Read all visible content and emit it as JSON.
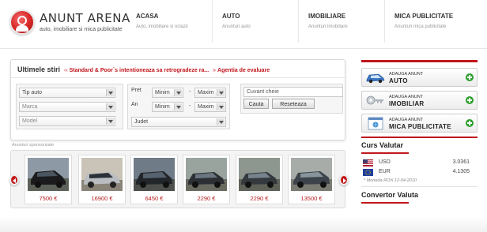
{
  "header": {
    "logo_title": "ANUNT ARENA",
    "logo_subtitle": "auto, imobiliare si mica publicitate",
    "nav": [
      {
        "label": "ACASA",
        "sub": "Auto, imobiliare si oclazii"
      },
      {
        "label": "AUTO",
        "sub": "Anunturi auto"
      },
      {
        "label": "IMOBILIARE",
        "sub": "Anunturi imobiliare"
      },
      {
        "label": "MICA PUBLICITATE",
        "sub": "Anunturi mica publicitate"
      }
    ]
  },
  "news": {
    "title": "Ultimele stiri",
    "arrow": "‹‹",
    "headline": "Standard & Poor`s intentioneaza sa retrogradeze ra...",
    "sep": "»",
    "source": "Agentia de evaluare"
  },
  "filters": {
    "tip": "Tip auto",
    "marca": "Marca",
    "model": "Model",
    "pret_label": "Pret",
    "an_label": "An",
    "pret_min": "Minim",
    "pret_max": "Maxim",
    "an_min": "Minim",
    "an_max": "Maxim",
    "dash": "-",
    "judet": "Judet",
    "keyword_placeholder": "Cuvant cheie",
    "search_button": "Cauta",
    "reset_button": "Reseteaza"
  },
  "sponsored": {
    "label": "Anunturi sponsorizate",
    "cars": [
      {
        "price": "7500 €"
      },
      {
        "price": "16900 €"
      },
      {
        "price": "6450 €"
      },
      {
        "price": "2290 €"
      },
      {
        "price": "2290 €"
      },
      {
        "price": "13500 €"
      }
    ]
  },
  "sidebar": {
    "add_buttons": [
      {
        "top": "ADAUGA ANUNT",
        "main": "AUTO",
        "icon": "car-icon"
      },
      {
        "top": "ADAUGA ANUNT",
        "main": "IMOBILIAR",
        "icon": "key-icon"
      },
      {
        "top": "ADAUGA ANUNT",
        "main": "MICA PUBLICITATE",
        "icon": "browser-icon"
      }
    ],
    "currency_title": "Curs Valutar",
    "currencies": [
      {
        "code": "USD",
        "value": "3.0361",
        "flag": "us-flag-icon"
      },
      {
        "code": "EUR",
        "value": "4.1305",
        "flag": "eu-flag-icon"
      }
    ],
    "currency_note": "* Moneda RON  12-04-2010",
    "converter_title": "Convertor Valuta"
  },
  "colors": {
    "accent_red": "#c0161c",
    "price_red": "#b31c1c",
    "plus_green": "#2ea02e"
  }
}
